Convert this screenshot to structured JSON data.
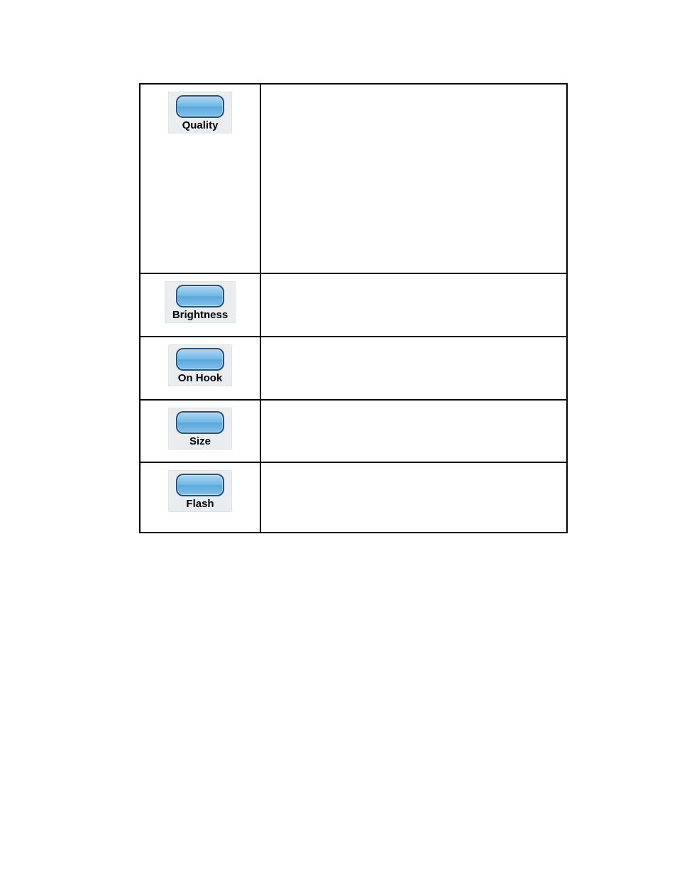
{
  "rows": [
    {
      "label": "Quality"
    },
    {
      "label": "Brightness"
    },
    {
      "label": "On Hook"
    },
    {
      "label": "Size"
    },
    {
      "label": "Flash"
    }
  ]
}
